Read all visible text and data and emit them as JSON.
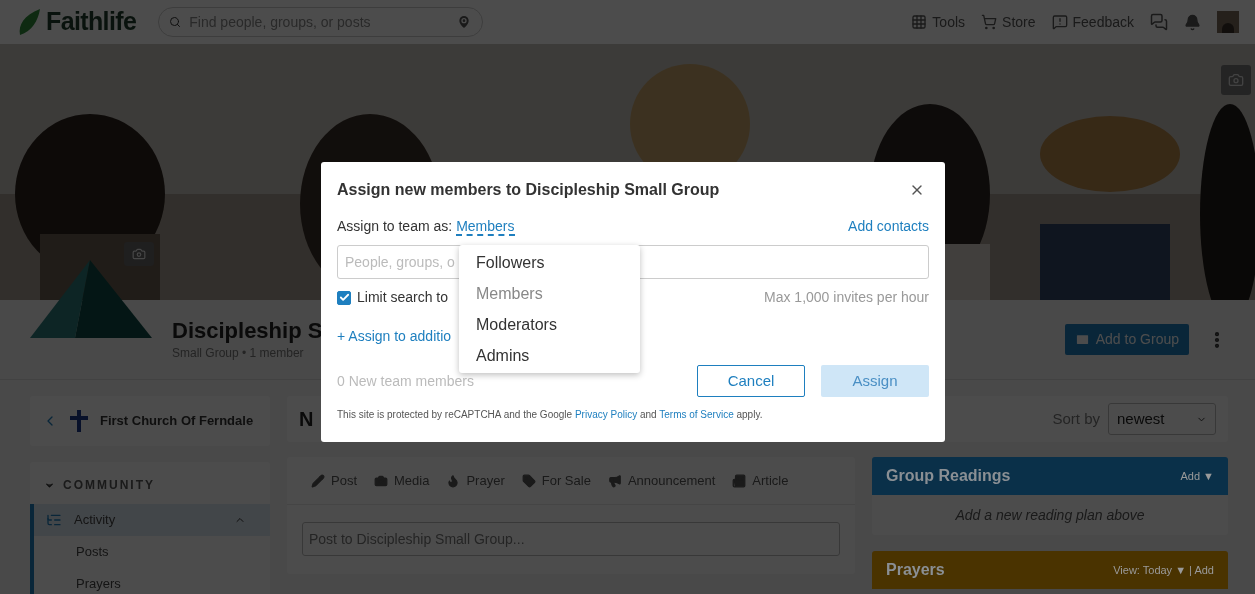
{
  "header": {
    "logo": "Faithlife",
    "search": {
      "placeholder": "Find people, groups, or posts"
    },
    "nav": [
      {
        "kind": "tools",
        "label": "Tools"
      },
      {
        "kind": "store",
        "label": "Store"
      },
      {
        "kind": "feedback",
        "label": "Feedback"
      }
    ]
  },
  "group": {
    "title": "Discipleship S",
    "subtitle": "Small Group • 1 member",
    "add_button": "Add to Group"
  },
  "sidebar": {
    "church": "First Church Of Ferndale",
    "section": {
      "label": "COMMUNITY",
      "expanded": true
    },
    "items": [
      {
        "label": "Activity",
        "selected": true,
        "expanded": true
      },
      {
        "label": "Posts",
        "selected": false
      },
      {
        "label": "Prayers",
        "selected": false
      }
    ]
  },
  "feed": {
    "heading": "N",
    "sort": {
      "label": "Sort by",
      "value": "newest"
    },
    "composer": {
      "tabs": [
        {
          "kind": "post",
          "label": "Post"
        },
        {
          "kind": "media",
          "label": "Media"
        },
        {
          "kind": "prayer",
          "label": "Prayer"
        },
        {
          "kind": "sale",
          "label": "For Sale"
        },
        {
          "kind": "announcement",
          "label": "Announcement"
        },
        {
          "kind": "article",
          "label": "Article"
        }
      ],
      "placeholder": "Post to Discipleship Small Group..."
    }
  },
  "widgets": [
    {
      "title": "Group Readings",
      "action": "Add ▼",
      "color": "#0a3049",
      "body": "Add a new reading plan above"
    },
    {
      "title": "Prayers",
      "action": "View: Today ▼ | Add",
      "color": "#4a3300"
    }
  ],
  "modal": {
    "title": "Assign new members to Discipleship Small Group",
    "role_label": "Assign to team as:",
    "role_value": "Members",
    "add_contacts": "Add contacts",
    "search": {
      "placeholder": "People, groups, o"
    },
    "limit_search": {
      "label": "Limit search to",
      "checked": true
    },
    "rate_note": "Max 1,000 invites per hour",
    "assign_more": "+ Assign to additio",
    "count": "0 New team members",
    "cancel": "Cancel",
    "assign": {
      "label": "Assign",
      "disabled": true
    },
    "footer": {
      "before": "This site is protected by reCAPTCHA and the Google",
      "privacy": "Privacy Policy",
      "middle": "and",
      "terms": "Terms of Service",
      "after": "apply."
    }
  },
  "role_menu": {
    "items": [
      {
        "label": "Followers",
        "selected": false
      },
      {
        "label": "Members",
        "selected": true
      },
      {
        "label": "Moderators",
        "selected": false
      },
      {
        "label": "Admins",
        "selected": false
      }
    ]
  }
}
